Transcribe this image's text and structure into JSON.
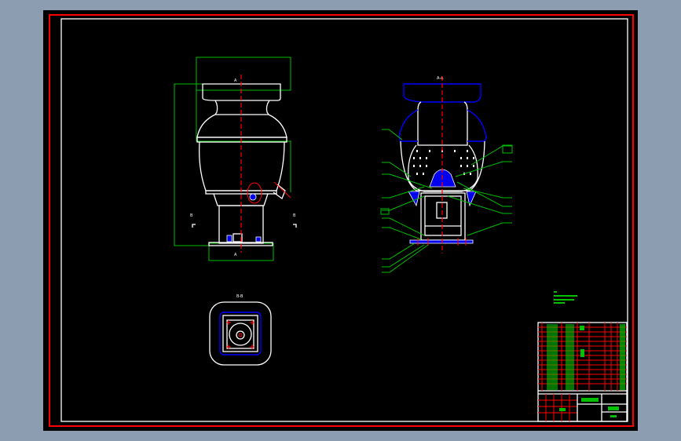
{
  "drawing": {
    "section_aa_label": "A-A",
    "section_bb_label": "B-B",
    "cut_marker_a": "A",
    "cut_marker_b": "B"
  },
  "colors": {
    "background": "#8c9cb1",
    "sheet": "#000000",
    "frame_outer": "#ff0000",
    "frame_inner": "#ffffff",
    "geometry": "#ffffff",
    "dimensions": "#00c000",
    "centerlines": "#ff0000",
    "hatch": "#0000ff"
  }
}
